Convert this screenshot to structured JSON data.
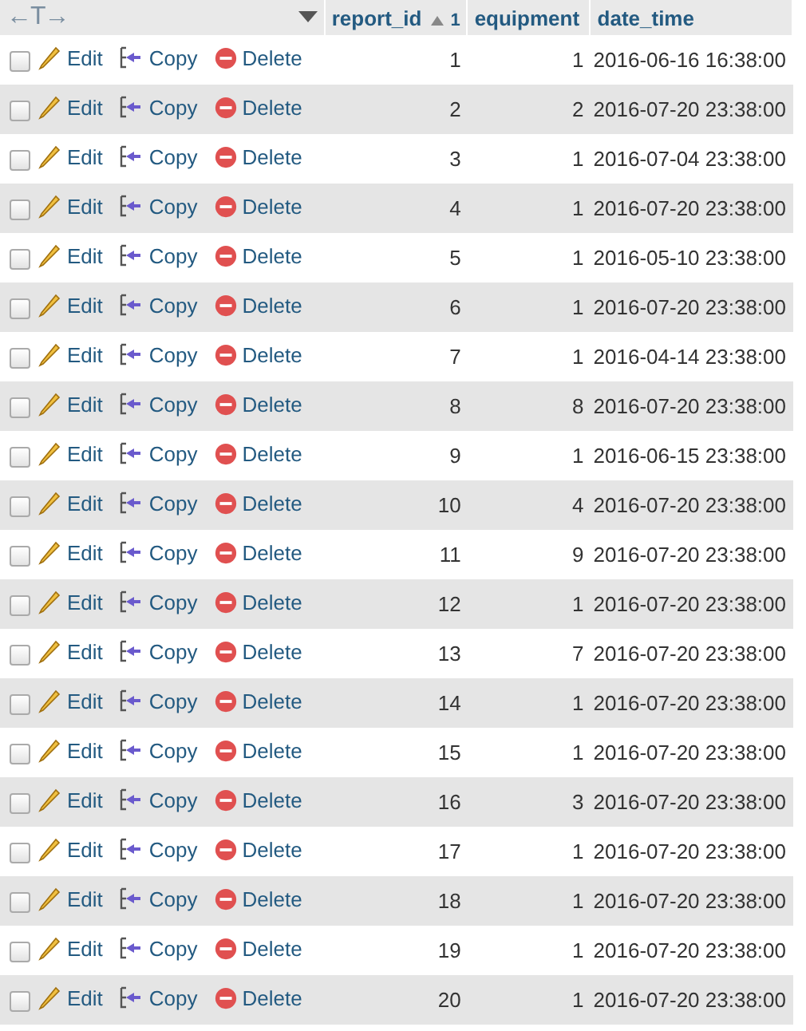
{
  "header": {
    "column_resize": "←T→",
    "columns": [
      {
        "label": "report_id",
        "sort_order": "1"
      },
      {
        "label": "equipment"
      },
      {
        "label": "date_time"
      }
    ]
  },
  "rows": [
    {
      "checked": false,
      "actions": [
        "Edit",
        "Copy",
        "Delete"
      ],
      "report_id": "1",
      "equipment": "1",
      "date_time": "2016-06-16 16:38:00"
    },
    {
      "checked": false,
      "actions": [
        "Edit",
        "Copy",
        "Delete"
      ],
      "report_id": "2",
      "equipment": "2",
      "date_time": "2016-07-20 23:38:00"
    },
    {
      "checked": false,
      "actions": [
        "Edit",
        "Copy",
        "Delete"
      ],
      "report_id": "3",
      "equipment": "1",
      "date_time": "2016-07-04 23:38:00"
    },
    {
      "checked": false,
      "actions": [
        "Edit",
        "Copy",
        "Delete"
      ],
      "report_id": "4",
      "equipment": "1",
      "date_time": "2016-07-20 23:38:00"
    },
    {
      "checked": false,
      "actions": [
        "Edit",
        "Copy",
        "Delete"
      ],
      "report_id": "5",
      "equipment": "1",
      "date_time": "2016-05-10 23:38:00"
    },
    {
      "checked": false,
      "actions": [
        "Edit",
        "Copy",
        "Delete"
      ],
      "report_id": "6",
      "equipment": "1",
      "date_time": "2016-07-20 23:38:00"
    },
    {
      "checked": false,
      "actions": [
        "Edit",
        "Copy",
        "Delete"
      ],
      "report_id": "7",
      "equipment": "1",
      "date_time": "2016-04-14 23:38:00"
    },
    {
      "checked": false,
      "actions": [
        "Edit",
        "Copy",
        "Delete"
      ],
      "report_id": "8",
      "equipment": "8",
      "date_time": "2016-07-20 23:38:00"
    },
    {
      "checked": false,
      "actions": [
        "Edit",
        "Copy",
        "Delete"
      ],
      "report_id": "9",
      "equipment": "1",
      "date_time": "2016-06-15 23:38:00"
    },
    {
      "checked": false,
      "actions": [
        "Edit",
        "Copy",
        "Delete"
      ],
      "report_id": "10",
      "equipment": "4",
      "date_time": "2016-07-20 23:38:00"
    },
    {
      "checked": false,
      "actions": [
        "Edit",
        "Copy",
        "Delete"
      ],
      "report_id": "11",
      "equipment": "9",
      "date_time": "2016-07-20 23:38:00"
    },
    {
      "checked": false,
      "actions": [
        "Edit",
        "Copy",
        "Delete"
      ],
      "report_id": "12",
      "equipment": "1",
      "date_time": "2016-07-20 23:38:00"
    },
    {
      "checked": false,
      "actions": [
        "Edit",
        "Copy",
        "Delete"
      ],
      "report_id": "13",
      "equipment": "7",
      "date_time": "2016-07-20 23:38:00"
    },
    {
      "checked": false,
      "actions": [
        "Edit",
        "Copy",
        "Delete"
      ],
      "report_id": "14",
      "equipment": "1",
      "date_time": "2016-07-20 23:38:00"
    },
    {
      "checked": false,
      "actions": [
        "Edit",
        "Copy",
        "Delete"
      ],
      "report_id": "15",
      "equipment": "1",
      "date_time": "2016-07-20 23:38:00"
    },
    {
      "checked": false,
      "actions": [
        "Edit",
        "Copy",
        "Delete"
      ],
      "report_id": "16",
      "equipment": "3",
      "date_time": "2016-07-20 23:38:00"
    },
    {
      "checked": false,
      "actions": [
        "Edit",
        "Copy",
        "Delete"
      ],
      "report_id": "17",
      "equipment": "1",
      "date_time": "2016-07-20 23:38:00"
    },
    {
      "checked": false,
      "actions": [
        "Edit",
        "Copy",
        "Delete"
      ],
      "report_id": "18",
      "equipment": "1",
      "date_time": "2016-07-20 23:38:00"
    },
    {
      "checked": false,
      "actions": [
        "Edit",
        "Copy",
        "Delete"
      ],
      "report_id": "19",
      "equipment": "1",
      "date_time": "2016-07-20 23:38:00"
    },
    {
      "checked": false,
      "actions": [
        "Edit",
        "Copy",
        "Delete"
      ],
      "report_id": "20",
      "equipment": "1",
      "date_time": "2016-07-20 23:38:00"
    }
  ]
}
